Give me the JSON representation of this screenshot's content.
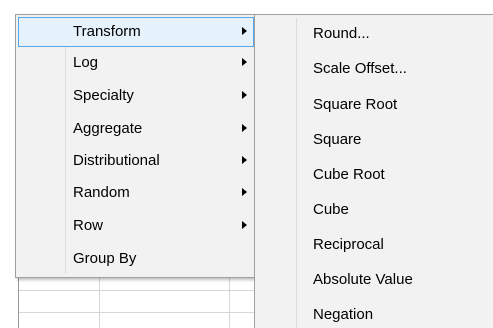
{
  "main_menu": {
    "items": [
      {
        "label": "Transform",
        "has_submenu": true,
        "active": true
      },
      {
        "label": "Log",
        "has_submenu": true
      },
      {
        "label": "Specialty",
        "has_submenu": true
      },
      {
        "label": "Aggregate",
        "has_submenu": true
      },
      {
        "label": "Distributional",
        "has_submenu": true
      },
      {
        "label": "Random",
        "has_submenu": true
      },
      {
        "label": "Row",
        "has_submenu": true
      },
      {
        "label": "Group By",
        "has_submenu": false
      }
    ]
  },
  "submenu": {
    "parent": "Transform",
    "items": [
      {
        "label": "Round..."
      },
      {
        "label": "Scale Offset..."
      },
      {
        "label": "Square Root"
      },
      {
        "label": "Square"
      },
      {
        "label": "Cube Root"
      },
      {
        "label": "Cube"
      },
      {
        "label": "Reciprocal"
      },
      {
        "label": "Absolute Value"
      },
      {
        "label": "Negation"
      }
    ]
  },
  "colors": {
    "menu_bg": "#f2f2f2",
    "highlight_bg": "#e5f1fb",
    "highlight_border": "#56a6e8",
    "border": "#a0a0a0"
  },
  "icons": {
    "submenu_arrow": "chevron-right-icon"
  }
}
